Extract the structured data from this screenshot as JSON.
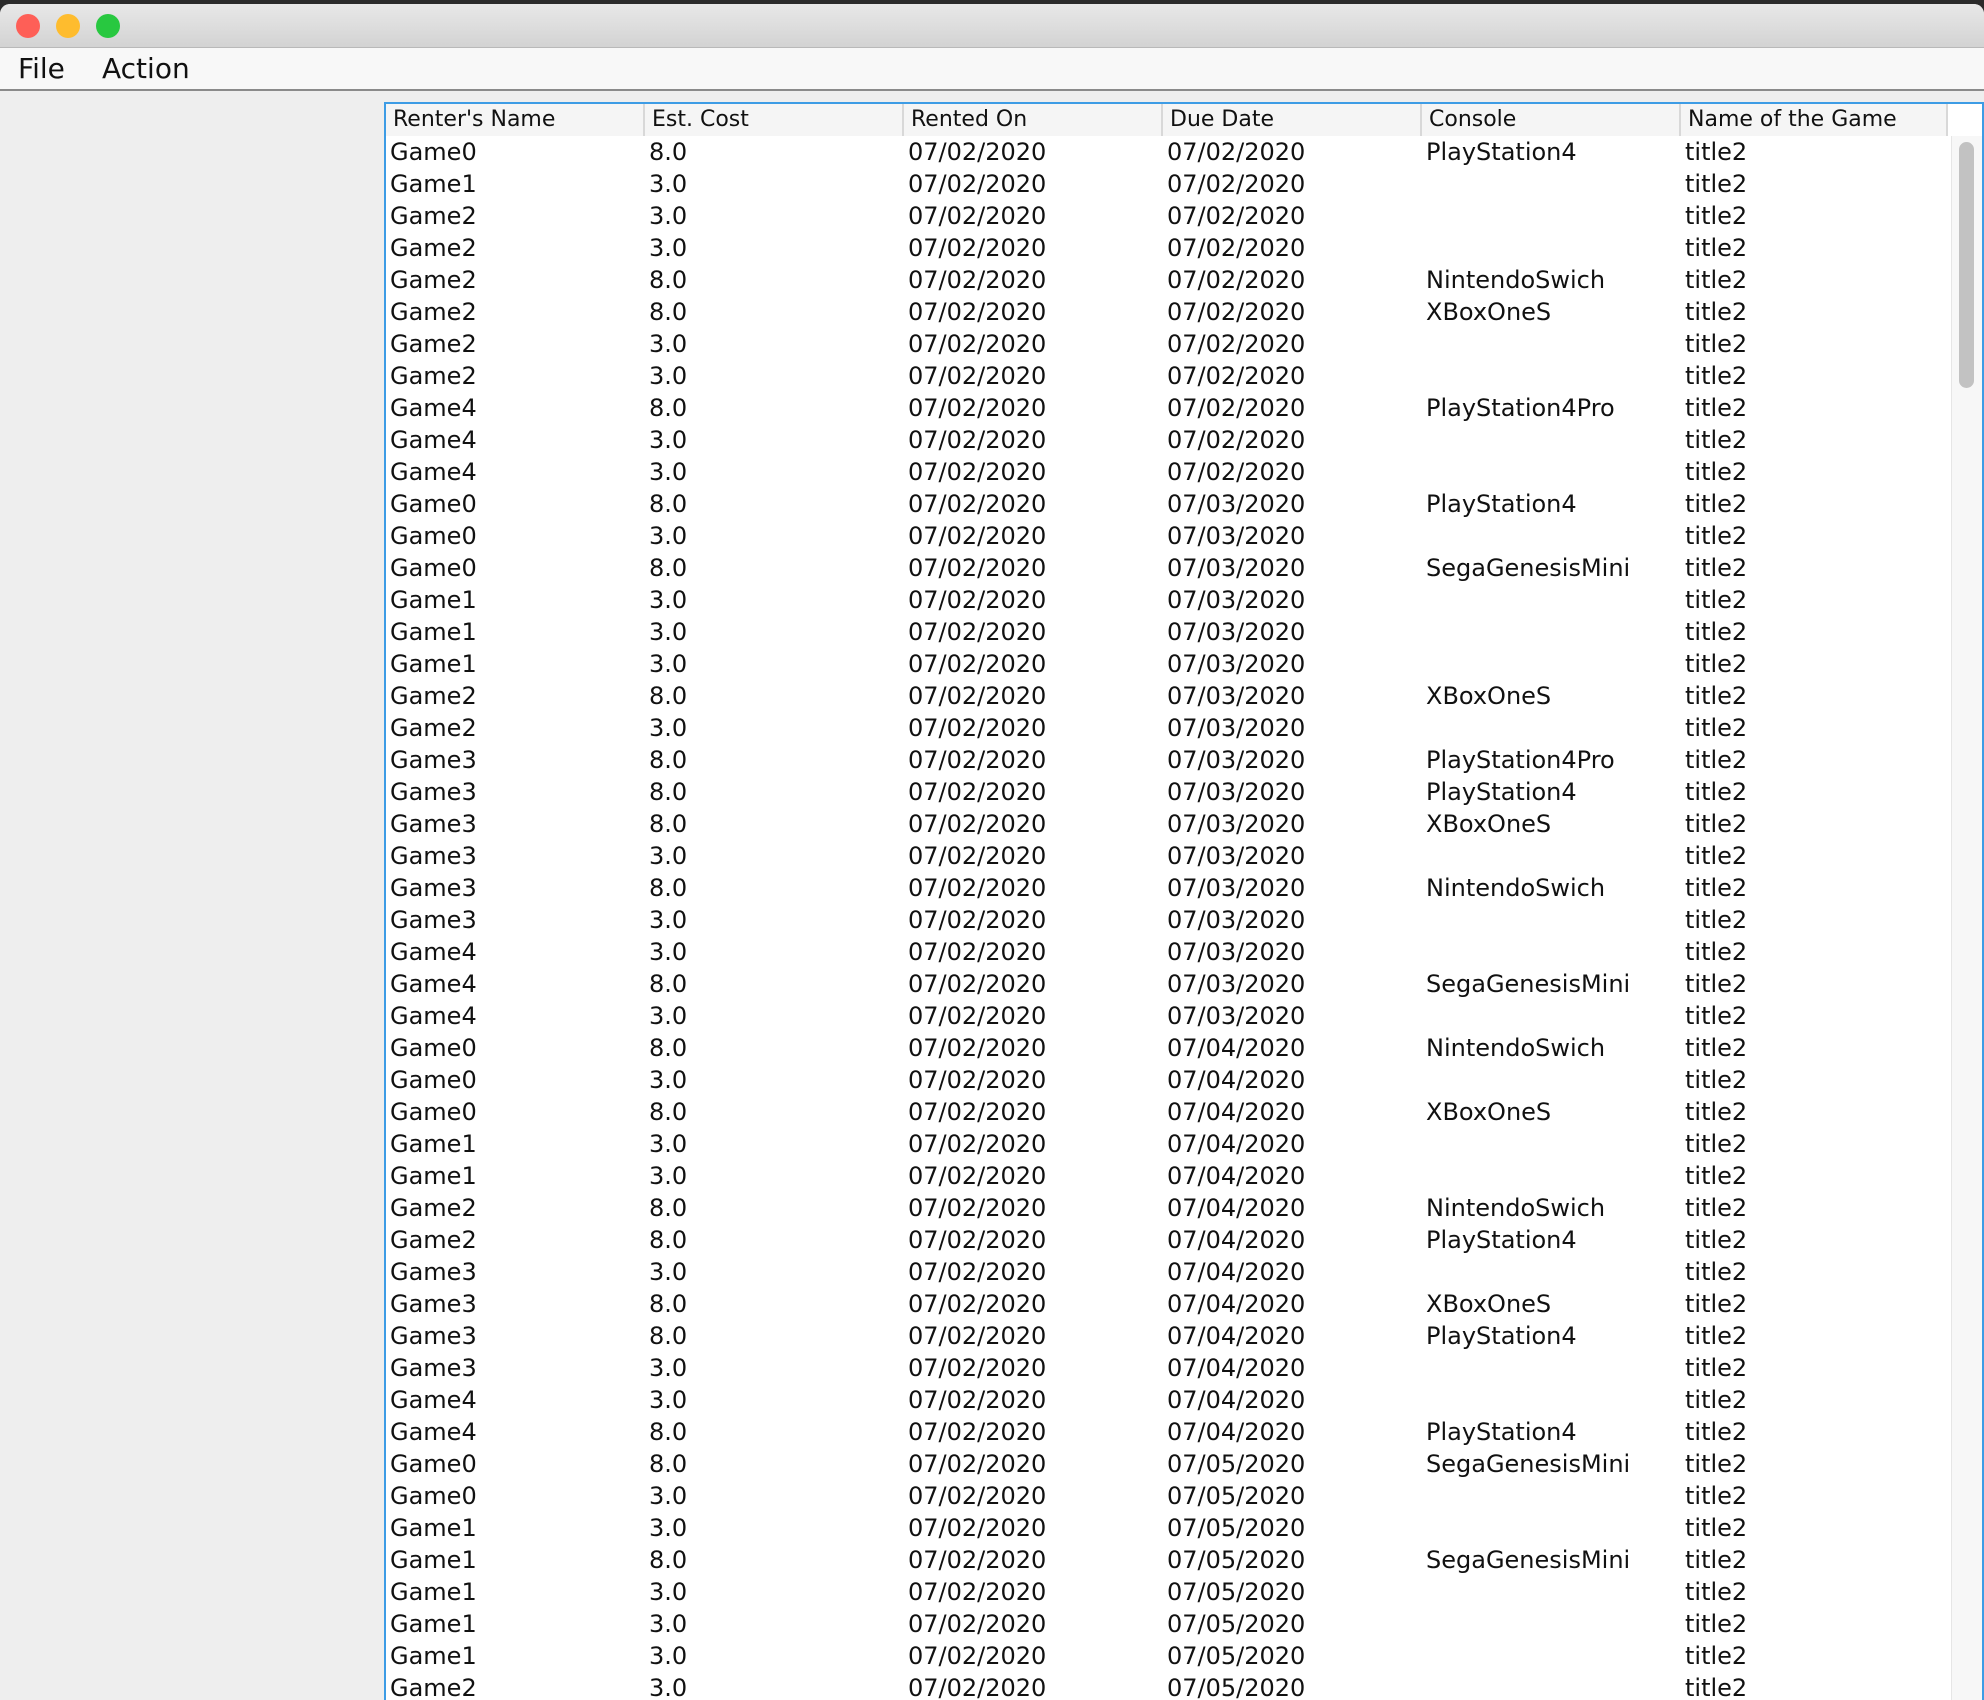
{
  "window": {
    "controls": [
      {
        "name": "close",
        "color": "#fe5f57"
      },
      {
        "name": "minimize",
        "color": "#febc2e"
      },
      {
        "name": "maximize",
        "color": "#28c840"
      }
    ]
  },
  "menu": {
    "items": [
      "File",
      "Action"
    ]
  },
  "table": {
    "accent_color": "#3d9ce5",
    "columns": [
      "Renter's Name",
      "Est. Cost",
      "Rented On",
      "Due Date",
      "Console",
      "Name of the Game"
    ],
    "rows": [
      [
        "Game0",
        "8.0",
        "07/02/2020",
        "07/02/2020",
        "PlayStation4",
        "title2"
      ],
      [
        "Game1",
        "3.0",
        "07/02/2020",
        "07/02/2020",
        "",
        "title2"
      ],
      [
        "Game2",
        "3.0",
        "07/02/2020",
        "07/02/2020",
        "",
        "title2"
      ],
      [
        "Game2",
        "3.0",
        "07/02/2020",
        "07/02/2020",
        "",
        "title2"
      ],
      [
        "Game2",
        "8.0",
        "07/02/2020",
        "07/02/2020",
        "NintendoSwich",
        "title2"
      ],
      [
        "Game2",
        "8.0",
        "07/02/2020",
        "07/02/2020",
        "XBoxOneS",
        "title2"
      ],
      [
        "Game2",
        "3.0",
        "07/02/2020",
        "07/02/2020",
        "",
        "title2"
      ],
      [
        "Game2",
        "3.0",
        "07/02/2020",
        "07/02/2020",
        "",
        "title2"
      ],
      [
        "Game4",
        "8.0",
        "07/02/2020",
        "07/02/2020",
        "PlayStation4Pro",
        "title2"
      ],
      [
        "Game4",
        "3.0",
        "07/02/2020",
        "07/02/2020",
        "",
        "title2"
      ],
      [
        "Game4",
        "3.0",
        "07/02/2020",
        "07/02/2020",
        "",
        "title2"
      ],
      [
        "Game0",
        "8.0",
        "07/02/2020",
        "07/03/2020",
        "PlayStation4",
        "title2"
      ],
      [
        "Game0",
        "3.0",
        "07/02/2020",
        "07/03/2020",
        "",
        "title2"
      ],
      [
        "Game0",
        "8.0",
        "07/02/2020",
        "07/03/2020",
        "SegaGenesisMini",
        "title2"
      ],
      [
        "Game1",
        "3.0",
        "07/02/2020",
        "07/03/2020",
        "",
        "title2"
      ],
      [
        "Game1",
        "3.0",
        "07/02/2020",
        "07/03/2020",
        "",
        "title2"
      ],
      [
        "Game1",
        "3.0",
        "07/02/2020",
        "07/03/2020",
        "",
        "title2"
      ],
      [
        "Game2",
        "8.0",
        "07/02/2020",
        "07/03/2020",
        "XBoxOneS",
        "title2"
      ],
      [
        "Game2",
        "3.0",
        "07/02/2020",
        "07/03/2020",
        "",
        "title2"
      ],
      [
        "Game3",
        "8.0",
        "07/02/2020",
        "07/03/2020",
        "PlayStation4Pro",
        "title2"
      ],
      [
        "Game3",
        "8.0",
        "07/02/2020",
        "07/03/2020",
        "PlayStation4",
        "title2"
      ],
      [
        "Game3",
        "8.0",
        "07/02/2020",
        "07/03/2020",
        "XBoxOneS",
        "title2"
      ],
      [
        "Game3",
        "3.0",
        "07/02/2020",
        "07/03/2020",
        "",
        "title2"
      ],
      [
        "Game3",
        "8.0",
        "07/02/2020",
        "07/03/2020",
        "NintendoSwich",
        "title2"
      ],
      [
        "Game3",
        "3.0",
        "07/02/2020",
        "07/03/2020",
        "",
        "title2"
      ],
      [
        "Game4",
        "3.0",
        "07/02/2020",
        "07/03/2020",
        "",
        "title2"
      ],
      [
        "Game4",
        "8.0",
        "07/02/2020",
        "07/03/2020",
        "SegaGenesisMini",
        "title2"
      ],
      [
        "Game4",
        "3.0",
        "07/02/2020",
        "07/03/2020",
        "",
        "title2"
      ],
      [
        "Game0",
        "8.0",
        "07/02/2020",
        "07/04/2020",
        "NintendoSwich",
        "title2"
      ],
      [
        "Game0",
        "3.0",
        "07/02/2020",
        "07/04/2020",
        "",
        "title2"
      ],
      [
        "Game0",
        "8.0",
        "07/02/2020",
        "07/04/2020",
        "XBoxOneS",
        "title2"
      ],
      [
        "Game1",
        "3.0",
        "07/02/2020",
        "07/04/2020",
        "",
        "title2"
      ],
      [
        "Game1",
        "3.0",
        "07/02/2020",
        "07/04/2020",
        "",
        "title2"
      ],
      [
        "Game2",
        "8.0",
        "07/02/2020",
        "07/04/2020",
        "NintendoSwich",
        "title2"
      ],
      [
        "Game2",
        "8.0",
        "07/02/2020",
        "07/04/2020",
        "PlayStation4",
        "title2"
      ],
      [
        "Game3",
        "3.0",
        "07/02/2020",
        "07/04/2020",
        "",
        "title2"
      ],
      [
        "Game3",
        "8.0",
        "07/02/2020",
        "07/04/2020",
        "XBoxOneS",
        "title2"
      ],
      [
        "Game3",
        "8.0",
        "07/02/2020",
        "07/04/2020",
        "PlayStation4",
        "title2"
      ],
      [
        "Game3",
        "3.0",
        "07/02/2020",
        "07/04/2020",
        "",
        "title2"
      ],
      [
        "Game4",
        "3.0",
        "07/02/2020",
        "07/04/2020",
        "",
        "title2"
      ],
      [
        "Game4",
        "8.0",
        "07/02/2020",
        "07/04/2020",
        "PlayStation4",
        "title2"
      ],
      [
        "Game0",
        "8.0",
        "07/02/2020",
        "07/05/2020",
        "SegaGenesisMini",
        "title2"
      ],
      [
        "Game0",
        "3.0",
        "07/02/2020",
        "07/05/2020",
        "",
        "title2"
      ],
      [
        "Game1",
        "3.0",
        "07/02/2020",
        "07/05/2020",
        "",
        "title2"
      ],
      [
        "Game1",
        "8.0",
        "07/02/2020",
        "07/05/2020",
        "SegaGenesisMini",
        "title2"
      ],
      [
        "Game1",
        "3.0",
        "07/02/2020",
        "07/05/2020",
        "",
        "title2"
      ],
      [
        "Game1",
        "3.0",
        "07/02/2020",
        "07/05/2020",
        "",
        "title2"
      ],
      [
        "Game1",
        "3.0",
        "07/02/2020",
        "07/05/2020",
        "",
        "title2"
      ],
      [
        "Game2",
        "3.0",
        "07/02/2020",
        "07/05/2020",
        "",
        "title2"
      ]
    ]
  }
}
